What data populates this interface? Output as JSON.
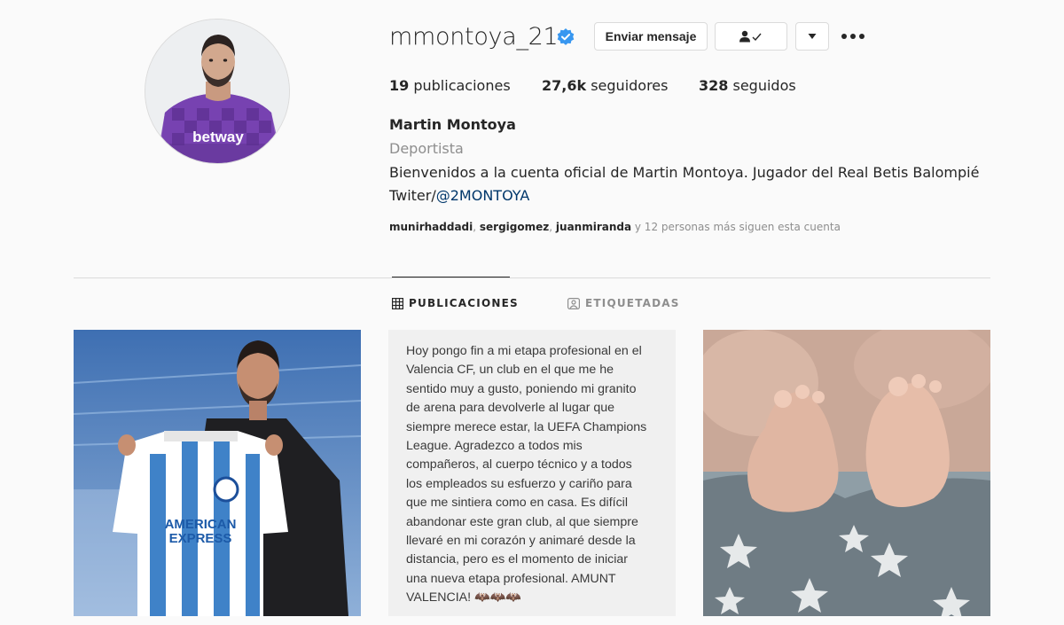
{
  "profile": {
    "username": "mmontoya_21",
    "verified": true,
    "message_button": "Enviar mensaje",
    "follow_icon": "person-check-icon",
    "dropdown_icon": "caret-down-icon",
    "more_icon": "more-dots-icon"
  },
  "stats": {
    "posts_count": "19",
    "posts_label": " publicaciones",
    "followers_count": "27,6k",
    "followers_label": " seguidores",
    "following_count": "328",
    "following_label": " seguidos"
  },
  "bio": {
    "full_name": "Martin Montoya",
    "category": "Deportista",
    "line1": "Bienvenidos a la cuenta oficial de Martin Montoya. Jugador del Real Betis Balompié",
    "line2_prefix": "Twiter/",
    "line2_mention": "@2MONTOYA"
  },
  "followed_by": {
    "user1": "munirhaddadi",
    "sep1": ", ",
    "user2": "sergigomez",
    "sep2": ", ",
    "user3": "juanmiranda",
    "suffix": " y 12 personas más siguen esta cuenta"
  },
  "tabs": [
    {
      "label": "PUBLICACIONES",
      "active": true,
      "icon": "grid-icon"
    },
    {
      "label": "ETIQUETADAS",
      "active": false,
      "icon": "tag-icon"
    }
  ],
  "posts": [
    {
      "type": "image",
      "description_icon": "player-jersey-photo"
    },
    {
      "type": "text",
      "lines": [
        "Hoy pongo fin a mi etapa profesional en el",
        "Valencia CF, un club en el que me he",
        "sentido muy a gusto, poniendo mi granito",
        "de arena para devolverle al lugar que",
        "siempre merece estar, la UEFA Champions",
        "League. Agradezco a todos mis",
        "compañeros, al cuerpo técnico y a todos",
        "los empleados su esfuerzo y cariño para",
        "que me sintiera como en casa. Es difícil",
        "abandonar este gran club, al que siempre",
        "llevaré en mi corazón y animaré desde la",
        "distancia, pero es el momento de iniciar",
        "una nueva etapa profesional. AMUNT",
        "VALENCIA! 🦇🦇🦇"
      ]
    },
    {
      "type": "image",
      "description_icon": "baby-feet-photo"
    }
  ],
  "colors": {
    "text": "#262626",
    "secondary": "#8e8e8e",
    "link": "#00376b",
    "verified": "#3897f0",
    "border": "#dbdbdb",
    "background": "#fafafa"
  }
}
